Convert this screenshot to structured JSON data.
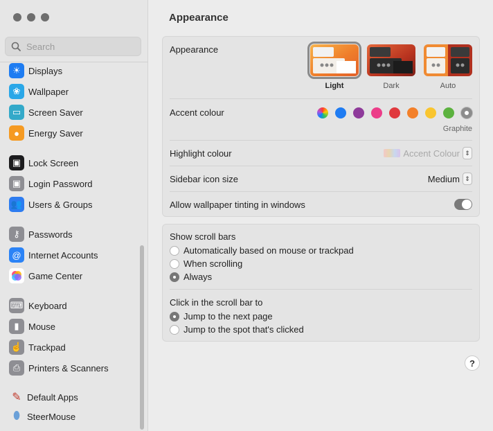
{
  "window": {
    "traffic_lights": [
      "close",
      "minimize",
      "zoom"
    ]
  },
  "search": {
    "placeholder": "Search"
  },
  "sidebar": {
    "items": [
      {
        "label": "Displays",
        "icon": "sun-icon",
        "color": "#1e7cf2"
      },
      {
        "label": "Wallpaper",
        "icon": "flower-icon",
        "color": "#2aa7e8"
      },
      {
        "label": "Screen Saver",
        "icon": "screen-saver-icon",
        "color": "#33a9c9"
      },
      {
        "label": "Energy Saver",
        "icon": "lightbulb-icon",
        "color": "#f59a22"
      },
      {
        "label": "Lock Screen",
        "icon": "lock-icon",
        "color": "#1c1c1e"
      },
      {
        "label": "Login Password",
        "icon": "padlock-icon",
        "color": "#8e8e93"
      },
      {
        "label": "Users & Groups",
        "icon": "users-icon",
        "color": "#2d7cf0"
      },
      {
        "label": "Passwords",
        "icon": "key-icon",
        "color": "#8e8e93"
      },
      {
        "label": "Internet Accounts",
        "icon": "at-icon",
        "color": "#2b83f6"
      },
      {
        "label": "Game Center",
        "icon": "game-center-icon",
        "color": "#ffffff"
      },
      {
        "label": "Keyboard",
        "icon": "keyboard-icon",
        "color": "#8e8e93"
      },
      {
        "label": "Mouse",
        "icon": "mouse-icon",
        "color": "#8e8e93"
      },
      {
        "label": "Trackpad",
        "icon": "trackpad-icon",
        "color": "#8e8e93"
      },
      {
        "label": "Printers & Scanners",
        "icon": "printer-icon",
        "color": "#8e8e93"
      },
      {
        "label": "Default Apps",
        "icon": "default-apps-icon",
        "color": "#f2f2f2"
      },
      {
        "label": "SteerMouse",
        "icon": "steermouse-icon",
        "color": "#f2f2f2"
      }
    ]
  },
  "main": {
    "title": "Appearance",
    "appearance": {
      "label": "Appearance",
      "options": [
        {
          "label": "Light",
          "selected": true
        },
        {
          "label": "Dark",
          "selected": false
        },
        {
          "label": "Auto",
          "selected": false
        }
      ]
    },
    "accent": {
      "label": "Accent colour",
      "colors": [
        "multicolor",
        "#1f7cf2",
        "#8e3a9a",
        "#ec3d89",
        "#e0393e",
        "#f3802a",
        "#f9c52f",
        "#5cb23f",
        "#8c8c8c"
      ],
      "selected_name": "Graphite"
    },
    "highlight": {
      "label": "Highlight colour",
      "value": "Accent Colour"
    },
    "sidebar_icon_size": {
      "label": "Sidebar icon size",
      "value": "Medium"
    },
    "wallpaper_tinting": {
      "label": "Allow wallpaper tinting in windows",
      "enabled": true
    },
    "scroll_bars": {
      "label": "Show scroll bars",
      "options": [
        {
          "label": "Automatically based on mouse or trackpad",
          "selected": false
        },
        {
          "label": "When scrolling",
          "selected": false
        },
        {
          "label": "Always",
          "selected": true
        }
      ]
    },
    "click_scroll": {
      "label": "Click in the scroll bar to",
      "options": [
        {
          "label": "Jump to the next page",
          "selected": true
        },
        {
          "label": "Jump to the spot that's clicked",
          "selected": false
        }
      ]
    },
    "help": "?"
  }
}
